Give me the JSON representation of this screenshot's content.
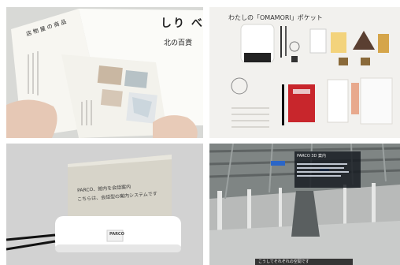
{
  "tiles": [
    {
      "id": "brochure-photo",
      "brand_vertical": "しり べし",
      "subtitle": "北の百貨",
      "panel_title": "店 物 屋 の 商 品",
      "colors": {
        "paper": "#f7f6f1",
        "background": "#d8d9d6"
      }
    },
    {
      "id": "omamori-pocket-photo",
      "heading": "わたしの「OMAMORI」ポケット",
      "colors": {
        "notebook": "#c8262c",
        "background": "#f2f1ee"
      }
    },
    {
      "id": "transparent-display-photo",
      "screen_text_line1": "PARCO、館内を会話案内",
      "screen_text_line2": "こちらは、会話型の案内システムです",
      "base_label": "PARCO",
      "colors": {
        "screen_tint": "#d7d4c8",
        "base": "#ffffff"
      }
    },
    {
      "id": "3d-office-render",
      "menu_title": "PARCO 3D 案内",
      "subtitle_bar": "こうしてそれぞれの空間です"
    }
  ]
}
